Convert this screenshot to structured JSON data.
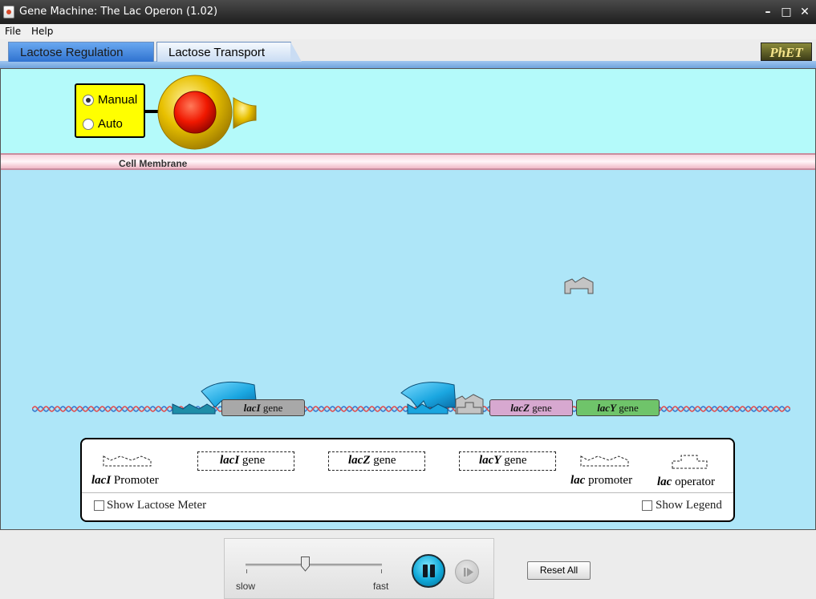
{
  "window": {
    "title": "Gene Machine: The Lac Operon (1.02)",
    "minimize": "–",
    "maximize": "□",
    "close": "✕"
  },
  "menu": {
    "items": [
      "File",
      "Help"
    ]
  },
  "tabs": [
    {
      "label": "Lactose Regulation",
      "selected": false
    },
    {
      "label": "Lactose Transport",
      "selected": true
    }
  ],
  "logo": "PhET",
  "injector": {
    "modes": [
      "Manual",
      "Auto"
    ],
    "selected_mode": "Manual"
  },
  "membrane_label": "Cell Membrane",
  "genes": {
    "lacI": {
      "italic": "lacI",
      "text": " gene"
    },
    "lacZ": {
      "italic": "lacZ",
      "text": " gene"
    },
    "lacY": {
      "italic": "lacY",
      "text": " gene"
    }
  },
  "legend": {
    "laci_promoter": {
      "italic": "lacI",
      "text": " Promoter"
    },
    "laci_gene": {
      "italic": "lacI",
      "text": " gene"
    },
    "lacz_gene": {
      "italic": "lacZ",
      "text": " gene"
    },
    "lacy_gene": {
      "italic": "lacY",
      "text": " gene"
    },
    "lac_promoter": {
      "italic": "lac",
      "text": " promoter"
    },
    "lac_operator": {
      "italic": "lac",
      "text": " operator"
    },
    "show_lactose_meter": "Show Lactose Meter",
    "show_legend": "Show Legend",
    "show_lactose_meter_checked": false,
    "show_legend_checked": false
  },
  "controls": {
    "speed_min_label": "slow",
    "speed_max_label": "fast",
    "speed_value": 0.45,
    "paused": false,
    "reset_label": "Reset All"
  },
  "colors": {
    "cell": "#aee6f8",
    "outside": "#b4fafa",
    "lacZ": "#d7a8d0",
    "lacY": "#6fc46a",
    "lacI": "#a8a8a8",
    "repressor": "#1aa6e0",
    "injector_panel": "#ffff00"
  }
}
